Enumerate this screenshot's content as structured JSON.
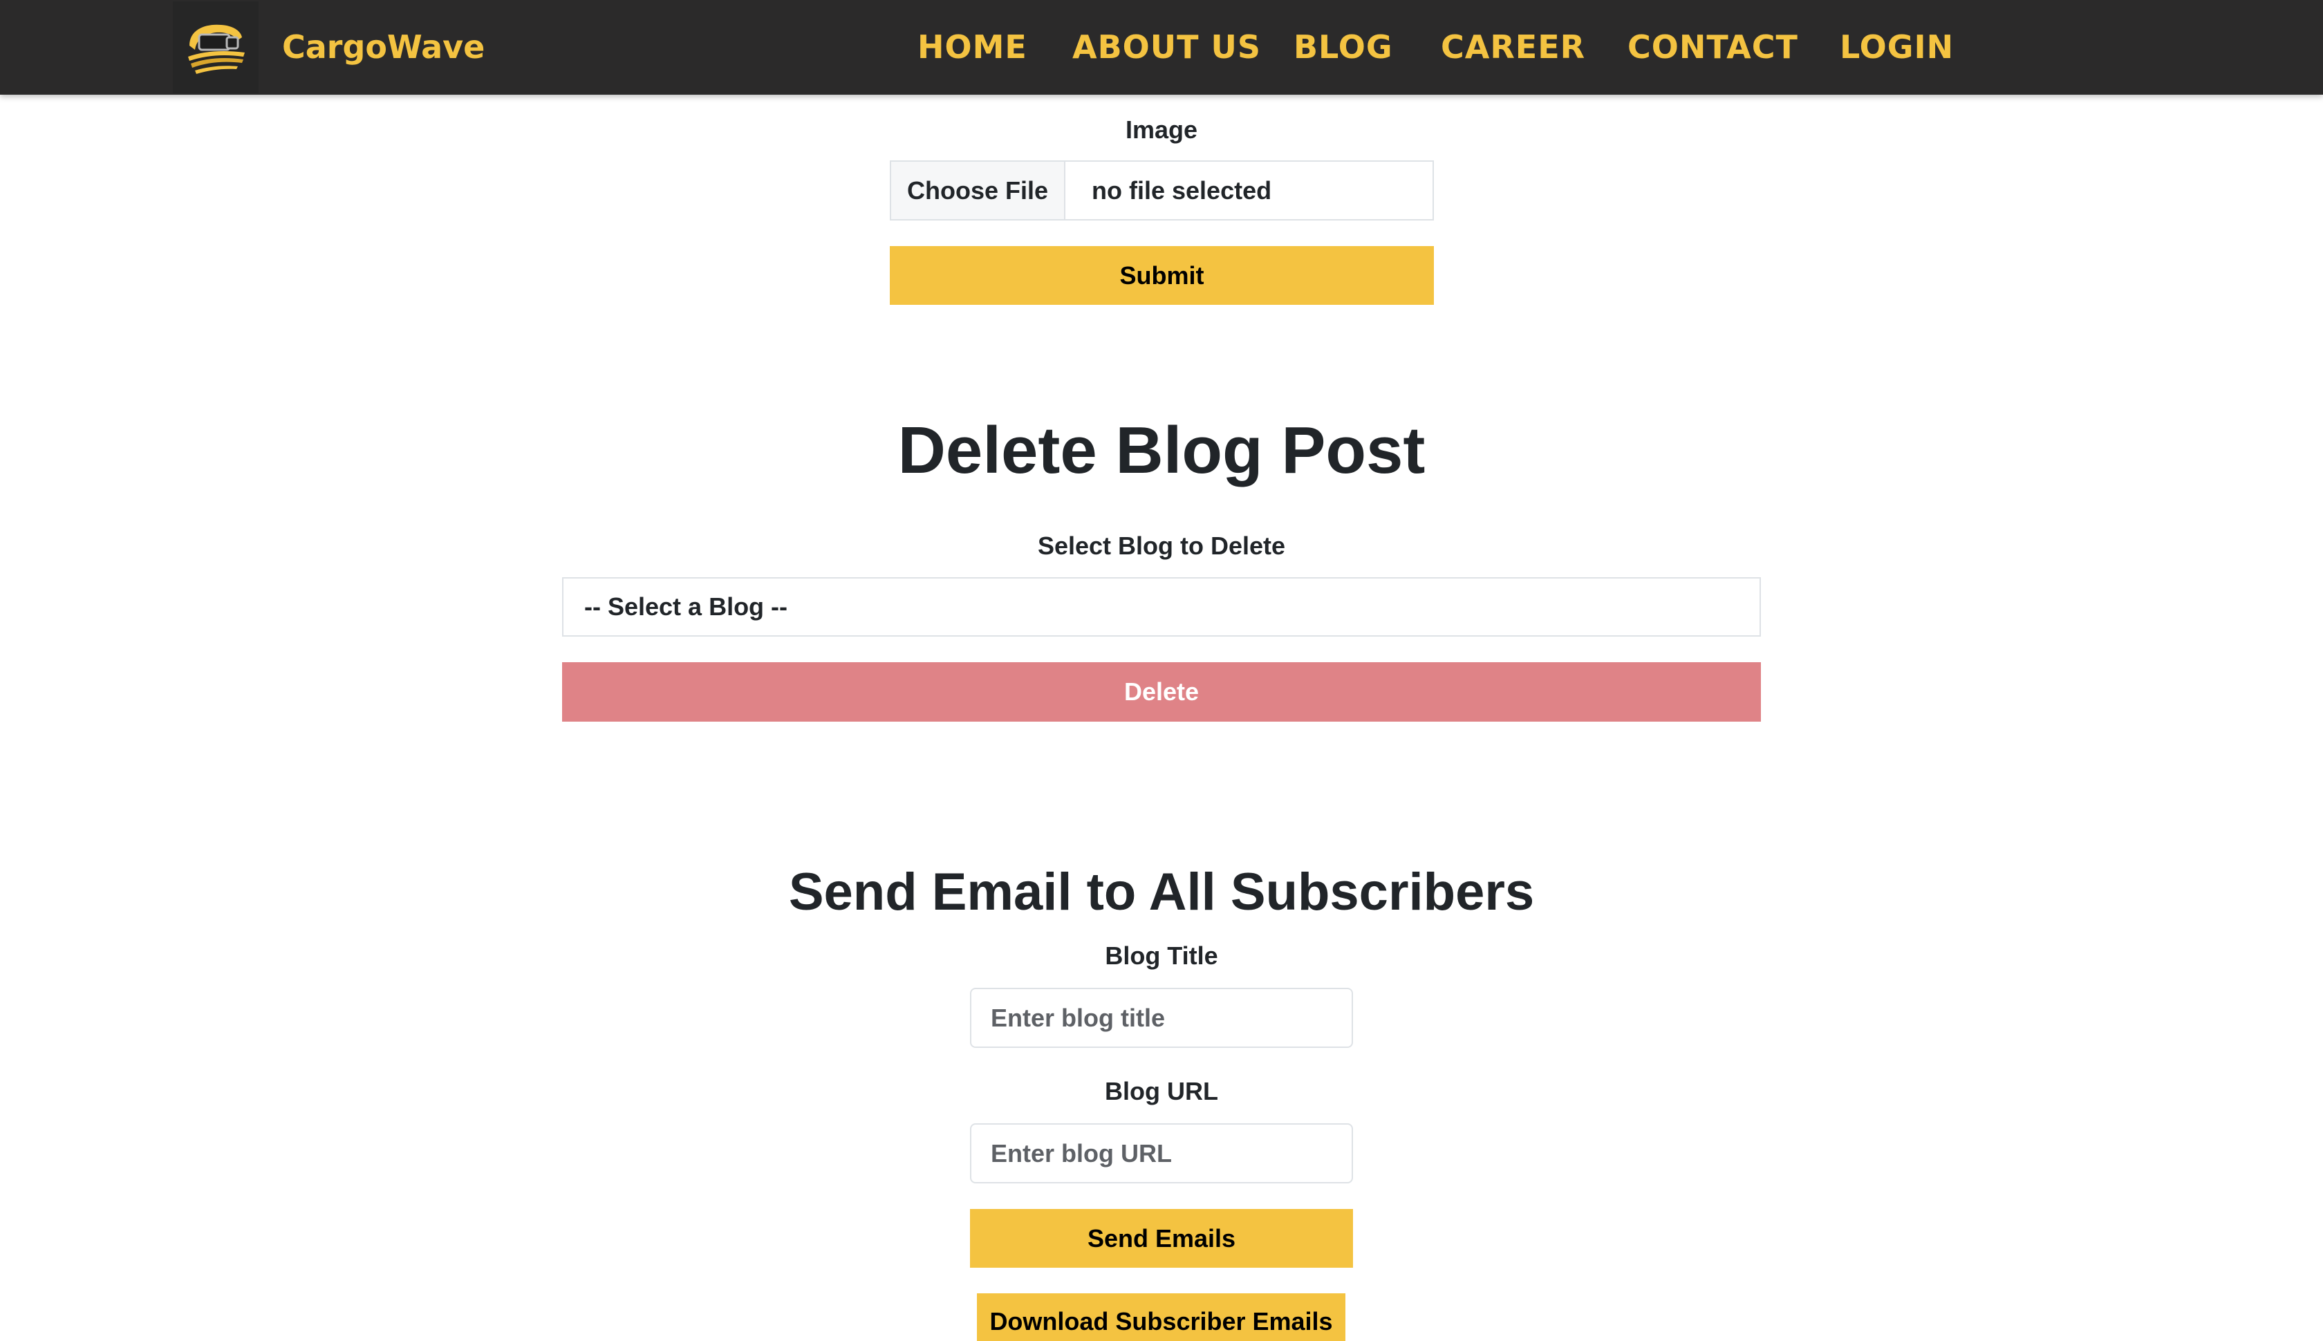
{
  "nav": {
    "brand": "CargoWave",
    "items": [
      "HOME",
      "ABOUT US",
      "BLOG",
      "CAREER",
      "CONTACT",
      "LOGIN"
    ]
  },
  "upload": {
    "image_label": "Image",
    "choose_file": "Choose File",
    "file_status": "no file selected",
    "submit": "Submit"
  },
  "delete": {
    "heading": "Delete Blog Post",
    "select_label": "Select Blog to Delete",
    "select_value": "-- Select a Blog --",
    "delete_button": "Delete"
  },
  "email": {
    "heading": "Send Email to All Subscribers",
    "title_label": "Blog Title",
    "title_placeholder": "Enter blog title",
    "url_label": "Blog URL",
    "url_placeholder": "Enter blog URL",
    "send_button": "Send Emails",
    "download_button": "Download Subscriber Emails"
  },
  "colors": {
    "navbar": "#2b2a2a",
    "accent": "#f4c341",
    "danger": "#df8387"
  }
}
